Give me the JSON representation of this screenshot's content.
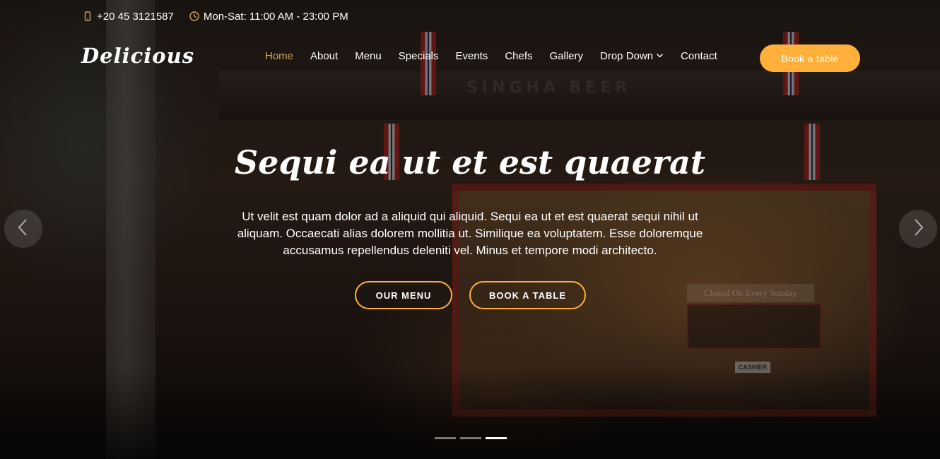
{
  "topbar": {
    "phone": "+20 45 3121587",
    "phone_icon": "phone-icon",
    "hours": "Mon-Sat: 11:00 AM - 23:00 PM",
    "hours_icon": "clock-icon"
  },
  "header": {
    "logo": "Delicious",
    "nav": [
      {
        "label": "Home",
        "active": true
      },
      {
        "label": "About"
      },
      {
        "label": "Menu"
      },
      {
        "label": "Specials"
      },
      {
        "label": "Events"
      },
      {
        "label": "Chefs"
      },
      {
        "label": "Gallery"
      },
      {
        "label": "Drop Down",
        "icon": "chevron-down-icon"
      },
      {
        "label": "Contact"
      }
    ],
    "book_button": "Book a table"
  },
  "hero": {
    "title": "Sequi ea ut et est quaerat",
    "text": "Ut velit est quam dolor ad a aliquid qui aliquid. Sequi ea ut et est quaerat sequi nihil ut aliquam. Occaecati alias dolorem mollitia ut. Similique ea voluptatem. Esse doloremque accusamus repellendus deleniti vel. Minus et tempore modi architecto.",
    "buttons": {
      "menu": "OUR MENU",
      "book": "BOOK A TABLE"
    },
    "active_slide": 3,
    "slide_count": 3
  },
  "background_signs": {
    "awning": "SINGHA BEER",
    "closed": "Closed On Every Sunday",
    "cashier": "CASHIER"
  },
  "colors": {
    "accent": "#cda45e",
    "button": "#ffb03b"
  }
}
